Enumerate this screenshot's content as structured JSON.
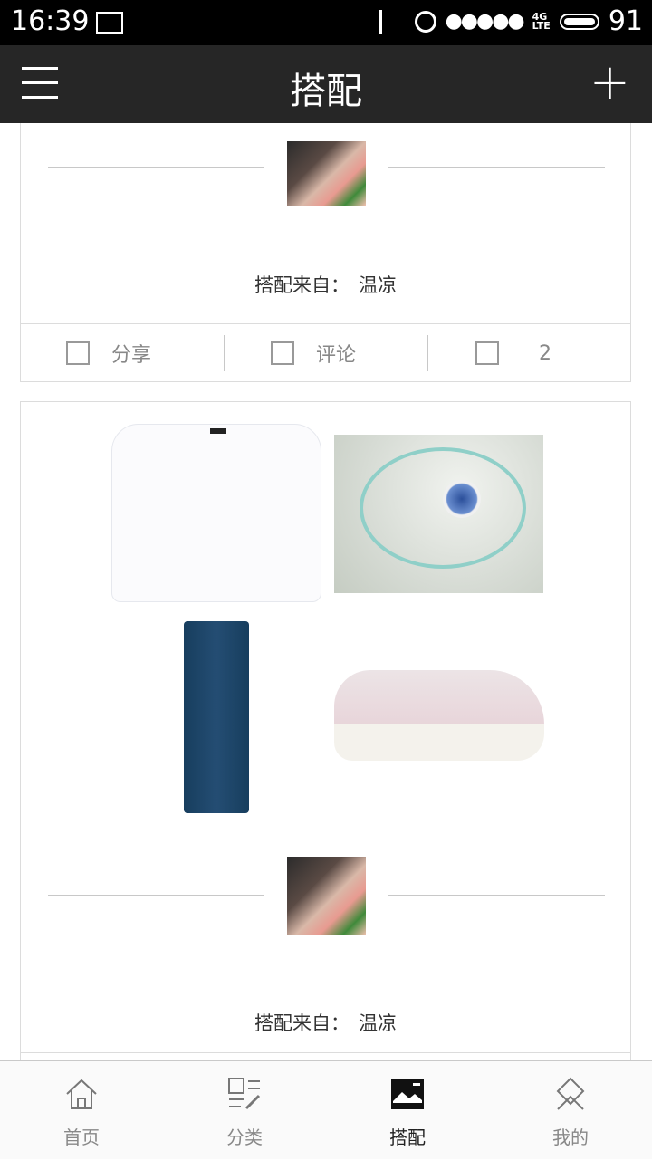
{
  "status_bar": {
    "time": "16:39",
    "network": "4G\nLTE",
    "battery": "91"
  },
  "header": {
    "title": "搭配",
    "add_label": "+"
  },
  "feed": {
    "cards": [
      {
        "source_prefix": "搭配来自：",
        "author": "温凉",
        "actions": {
          "share": "分享",
          "comment": "评论",
          "like_count": "2"
        }
      },
      {
        "source_prefix": "搭配来自：",
        "author": "温凉",
        "items": [
          "white-blouse",
          "turquoise-necklace",
          "blue-jeans",
          "pink-sneakers"
        ]
      }
    ]
  },
  "tabbar": {
    "tabs": [
      {
        "label": "首页",
        "icon": "home-icon"
      },
      {
        "label": "分类",
        "icon": "category-icon"
      },
      {
        "label": "搭配",
        "icon": "outfit-icon",
        "active": true
      },
      {
        "label": "我的",
        "icon": "profile-icon"
      }
    ]
  },
  "colors": {
    "header_bg": "#262626",
    "status_bg": "#000000",
    "border": "#dcdcdc",
    "muted_text": "#888888"
  }
}
